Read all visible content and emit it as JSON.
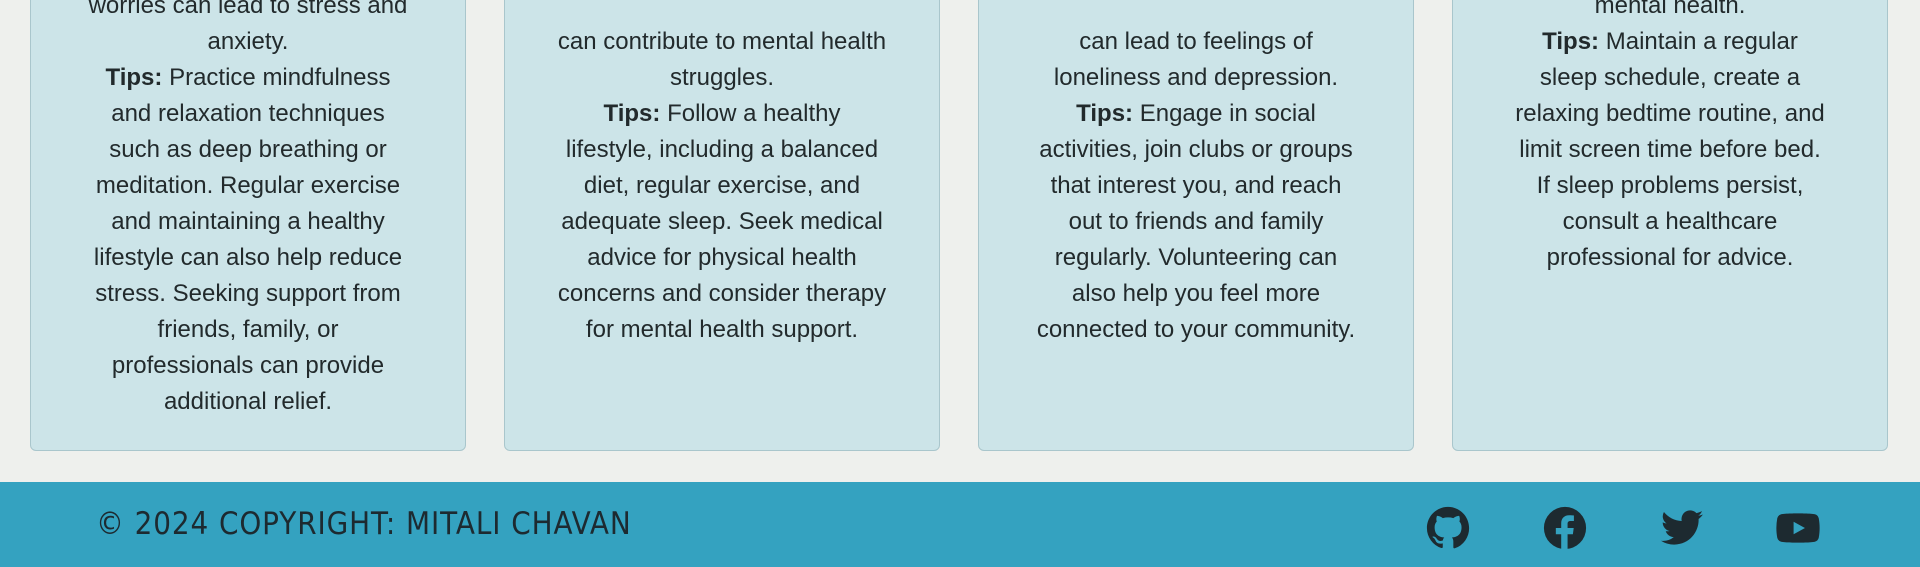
{
  "cards": [
    {
      "lines_intro": "worries can lead to stress and anxiety.",
      "tips_label": "Tips:",
      "tips_text": " Practice mindfulness and relaxation techniques such as deep breathing or meditation. Regular exercise and maintaining a healthy lifestyle can also help reduce stress. Seeking support from friends, family, or professionals can provide additional relief."
    },
    {
      "lines_intro": "can contribute to mental health struggles.",
      "tips_label": "Tips:",
      "tips_text": " Follow a healthy lifestyle, including a balanced diet, regular exercise, and adequate sleep. Seek medical advice for physical health concerns and consider therapy for mental health support."
    },
    {
      "lines_intro": "can lead to feelings of loneliness and depression.",
      "tips_label": "Tips:",
      "tips_text": " Engage in social activities, join clubs or groups that interest you, and reach out to friends and family regularly. Volunteering can also help you feel more connected to your community."
    },
    {
      "lines_intro": "mental health.",
      "tips_label": "Tips:",
      "tips_text": " Maintain a regular sleep schedule, create a relaxing bedtime routine, and limit screen time before bed. If sleep problems persist, consult a healthcare professional for advice."
    }
  ],
  "footer": {
    "copyright": "© 2024 Copyright: Mitali Chavan",
    "social_icons": [
      "github-icon",
      "facebook-icon",
      "twitter-icon",
      "youtube-icon"
    ]
  },
  "colors": {
    "page_background": "#eef0ed",
    "card_background": "#cce4e8",
    "footer_background": "#34a2c0",
    "text": "#222a2c",
    "footer_text": "#1d2a30"
  }
}
